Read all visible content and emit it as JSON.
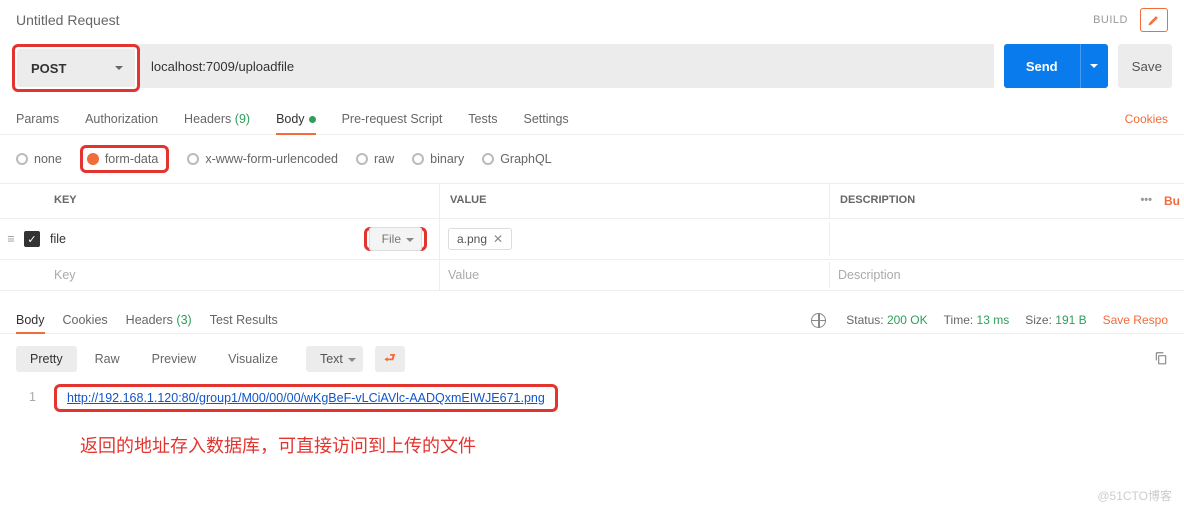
{
  "header": {
    "title": "Untitled Request",
    "build": "BUILD"
  },
  "request": {
    "method": "POST",
    "url": "localhost:7009/uploadfile",
    "send": "Send",
    "save": "Save"
  },
  "tabs": {
    "params": "Params",
    "auth": "Authorization",
    "headers_label": "Headers",
    "headers_count": "(9)",
    "body": "Body",
    "prereq": "Pre-request Script",
    "tests": "Tests",
    "settings": "Settings",
    "cookies": "Cookies"
  },
  "body_types": {
    "none": "none",
    "form_data": "form-data",
    "urlencoded": "x-www-form-urlencoded",
    "raw": "raw",
    "binary": "binary",
    "graphql": "GraphQL"
  },
  "table": {
    "head_key": "KEY",
    "head_value": "VALUE",
    "head_desc": "DESCRIPTION",
    "bulk": "Bu",
    "row1_key": "file",
    "row1_type": "File",
    "row1_value": "a.png",
    "ph_key": "Key",
    "ph_value": "Value",
    "ph_desc": "Description"
  },
  "response": {
    "tabs": {
      "body": "Body",
      "cookies": "Cookies",
      "headers_label": "Headers",
      "headers_count": "(3)",
      "tests": "Test Results"
    },
    "status_label": "Status:",
    "status_value": "200 OK",
    "time_label": "Time:",
    "time_value": "13 ms",
    "size_label": "Size:",
    "size_value": "191 B",
    "save": "Save Respo"
  },
  "view": {
    "pretty": "Pretty",
    "raw": "Raw",
    "preview": "Preview",
    "visualize": "Visualize",
    "format": "Text"
  },
  "code": {
    "line_no": "1",
    "url": "http://192.168.1.120:80/group1/M00/00/00/wKgBeF-vLCiAVlc-AADQxmEIWJE671.png"
  },
  "annotation": "返回的地址存入数据库，可直接访问到上传的文件",
  "watermark": "@51CTO博客"
}
